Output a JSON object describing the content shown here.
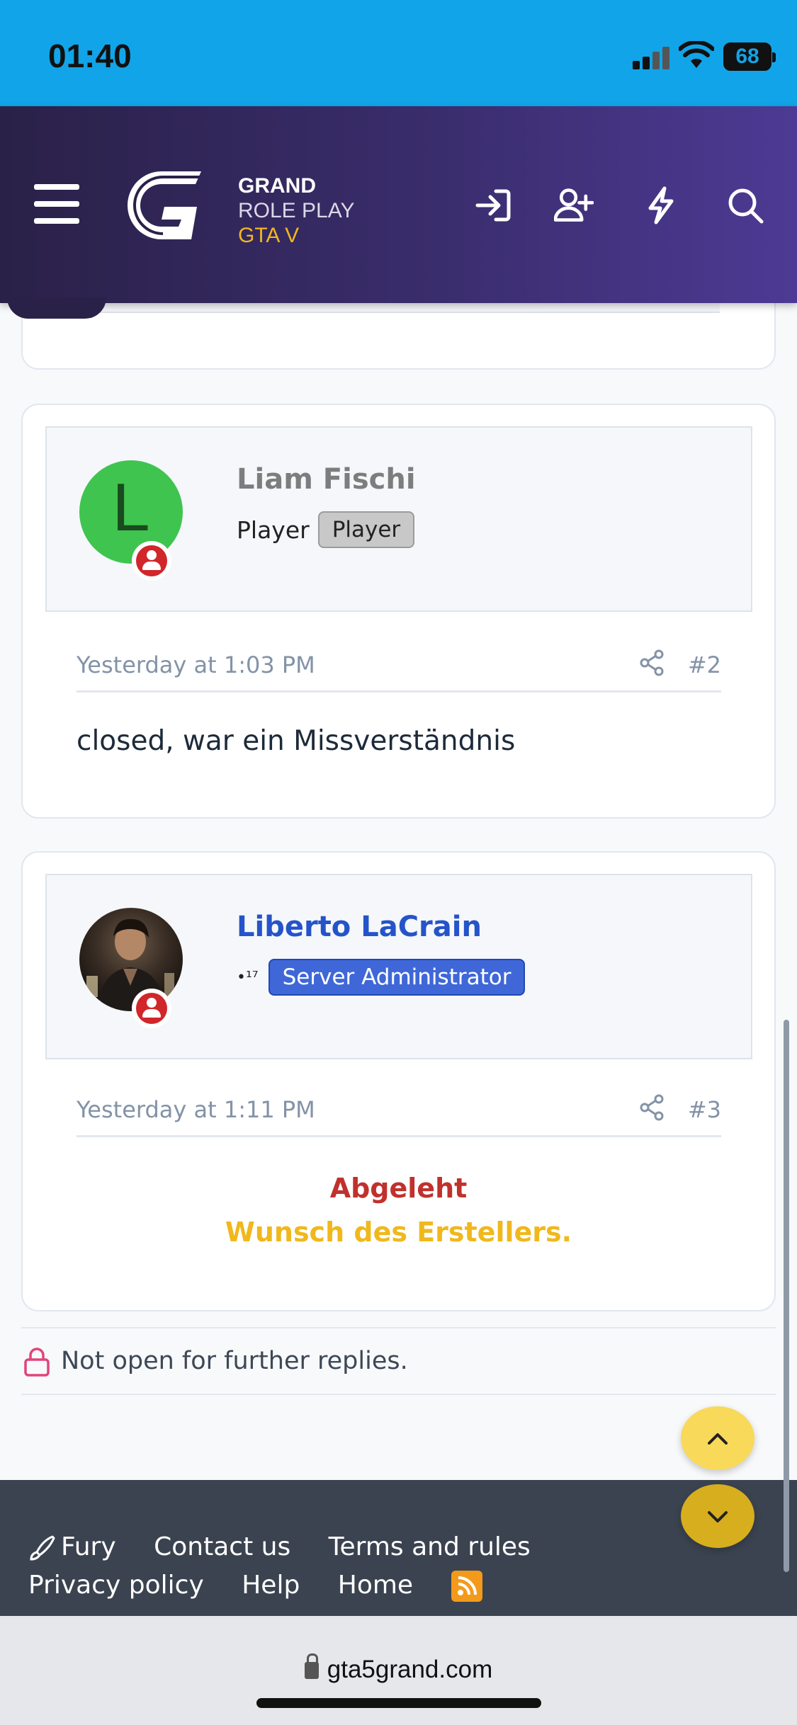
{
  "status_bar": {
    "time": "01:40",
    "battery": "68"
  },
  "header": {
    "logo_line1": "GRAND",
    "logo_line2": "ROLE PLAY",
    "logo_line3": "GTA V",
    "icons": [
      "login-icon",
      "register-icon",
      "whats-new-icon",
      "search-icon"
    ]
  },
  "posts": [
    {
      "avatar_letter": "L",
      "avatar_color": "#3fc44f",
      "username": "Liam Fischi",
      "username_color": "#7d7d7d",
      "user_title": "Player",
      "banner": "Player",
      "date": "Yesterday at 1:03 PM",
      "number": "#2",
      "content": "closed, war ein Missverständnis"
    },
    {
      "username": "Liberto LaCrain",
      "username_color": "#2553c9",
      "user_title_prefix": "•¹⁷",
      "banner": "Server Administrator",
      "date": "Yesterday at 1:11 PM",
      "number": "#3",
      "content_line1": "Abgeleht",
      "content_line1_color": "#c0312d",
      "content_line2": "Wunsch des Erstellers.",
      "content_line2_color": "#f0b81c"
    }
  ],
  "notice": {
    "text": "Not open for further replies."
  },
  "footer": {
    "links": [
      "Fury",
      "Contact us",
      "Terms and rules",
      "Privacy policy",
      "Help",
      "Home"
    ]
  },
  "browser": {
    "url": "gta5grand.com"
  }
}
